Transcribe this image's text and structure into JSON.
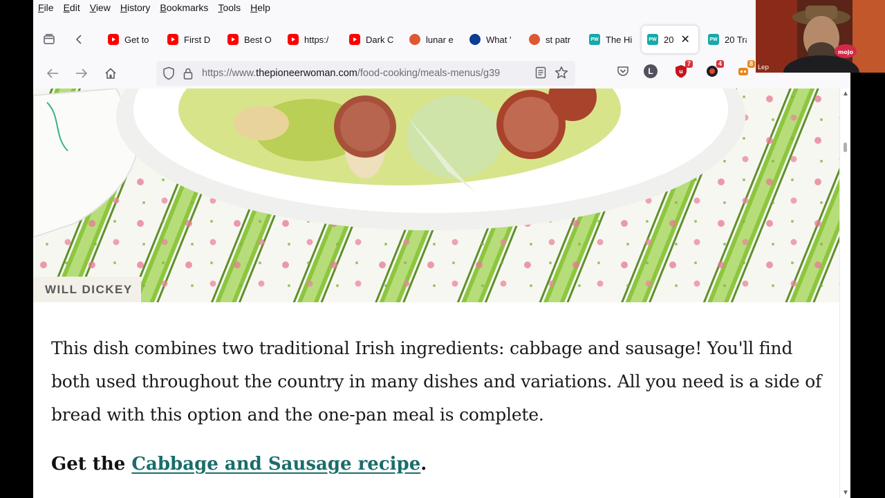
{
  "menubar": {
    "items": [
      {
        "ul": "F",
        "rest": "ile"
      },
      {
        "ul": "E",
        "rest": "dit"
      },
      {
        "ul": "V",
        "rest": "iew"
      },
      {
        "ul": "H",
        "rest": "istory"
      },
      {
        "ul": "B",
        "rest": "ookmarks"
      },
      {
        "ul": "T",
        "rest": "ools"
      },
      {
        "ul": "H",
        "rest": "elp"
      }
    ]
  },
  "tabs": [
    {
      "favicon": "youtube-icon",
      "title": "Get to"
    },
    {
      "favicon": "youtube-icon",
      "title": "First D"
    },
    {
      "favicon": "youtube-icon",
      "title": "Best O"
    },
    {
      "favicon": "youtube-icon",
      "title": "https:/"
    },
    {
      "favicon": "youtube-icon",
      "title": "Dark C"
    },
    {
      "favicon": "duckduckgo-icon",
      "title": "lunar e"
    },
    {
      "favicon": "nasa-icon",
      "title": "What '"
    },
    {
      "favicon": "duckduckgo-icon",
      "title": "st patr"
    },
    {
      "favicon": "pioneer-woman-icon",
      "title": "The Hi"
    },
    {
      "favicon": "pioneer-woman-icon",
      "title": "20 ",
      "active": true
    },
    {
      "favicon": "pioneer-woman-icon",
      "title": "20 Tra"
    }
  ],
  "favicon_text": {
    "pioneer_woman": "PW"
  },
  "urlbar": {
    "prefix": "https://www.",
    "domain": "thepioneerwoman.com",
    "path": "/food-cooking/meals-menus/g39"
  },
  "extensions": [
    {
      "name": "pocket-icon"
    },
    {
      "name": "account-icon",
      "letter": "L"
    },
    {
      "name": "ublock-icon",
      "badge": "7",
      "badge_color": "#e0303a"
    },
    {
      "name": "extension-red-icon",
      "badge": "4",
      "badge_color": "#e0303a"
    },
    {
      "name": "extension-orange-icon",
      "badge": "8",
      "badge_color": "#e8891e"
    }
  ],
  "webcam": {
    "label": "Lep"
  },
  "article": {
    "photo_credit": "WILL DICKEY",
    "paragraph": "This dish combines two traditional Irish ingredients: cabbage and sausage! You'll find both used throughout the country in many dishes and variations. All you need is a side of bread with this option and the one-pan meal is complete.",
    "cta_prefix": "Get the ",
    "cta_link": "Cabbage and Sausage recipe",
    "cta_suffix": "."
  },
  "colors": {
    "link": "#1a6d6a",
    "pioneer_woman_brand": "#19a9a7",
    "youtube": "#ff0000"
  }
}
